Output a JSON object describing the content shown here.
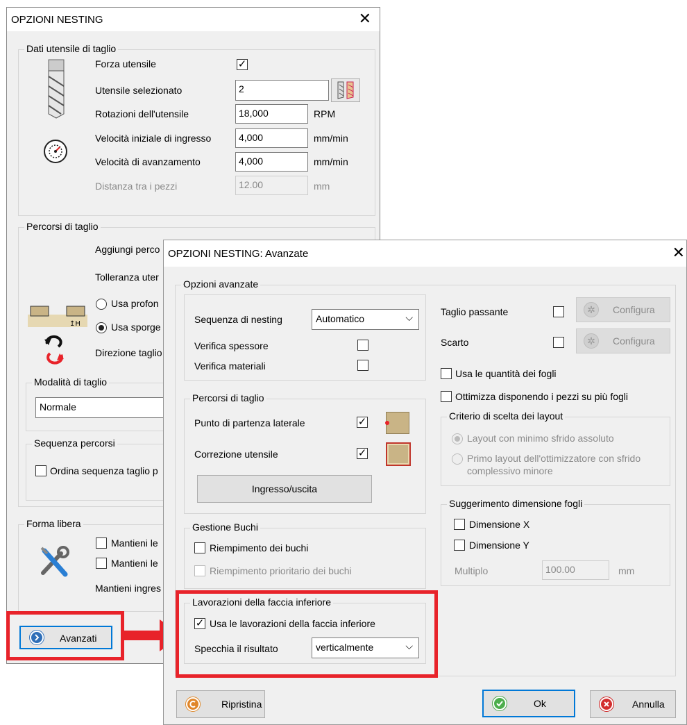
{
  "main": {
    "title": "OPZIONI NESTING",
    "close": "✕",
    "tool_group": {
      "label": "Dati utensile di taglio",
      "force_label": "Forza utensile",
      "force_checked": "✓",
      "selected_label": "Utensile selezionato",
      "selected_value": "2",
      "rotation_label": "Rotazioni dell'utensile",
      "rotation_value": "18,000",
      "rotation_unit": "RPM",
      "entry_speed_label": "Velocità iniziale di ingresso",
      "entry_speed_value": "4,000",
      "entry_speed_unit": "mm/min",
      "feed_label": "Velocità di avanzamento",
      "feed_value": "4,000",
      "feed_unit": "mm/min",
      "distance_label": "Distanza tra i pezzi",
      "distance_value": "12.00",
      "distance_unit": "mm"
    },
    "paths_group": {
      "label": "Percorsi di taglio",
      "add_label": "Aggiungi perco",
      "tolerance_label": "Tolleranza uter",
      "radio1_label": "Usa profon",
      "radio2_label": "Usa sporge",
      "direction_label": "Direzione taglio"
    },
    "mode_group": {
      "label": "Modalità di taglio",
      "value": "Normale"
    },
    "sequence_group": {
      "label": "Sequenza percorsi",
      "check_label": "Ordina sequenza taglio p"
    },
    "free_group": {
      "label": "Forma libera",
      "check1_label": "Mantieni le",
      "check2_label": "Mantieni le",
      "entry_label": "Mantieni ingres"
    },
    "advanced_button": "Avanzati"
  },
  "adv": {
    "title": "OPZIONI NESTING: Avanzate",
    "close": "✕",
    "group_label": "Opzioni avanzate",
    "nesting_seq_label": "Sequenza di nesting",
    "nesting_seq_value": "Automatico",
    "verify_thickness": "Verifica spessore",
    "verify_materials": "Verifica materiali",
    "paths": {
      "label": "Percorsi di taglio",
      "start_label": "Punto di partenza laterale",
      "start_checked": "✓",
      "correction_label": "Correzione utensile",
      "correction_checked": "✓",
      "inout_button": "Ingresso/uscita"
    },
    "holes": {
      "label": "Gestione Buchi",
      "fill_label": "Riempimento dei buchi",
      "priority_label": "Riempimento prioritario dei buchi"
    },
    "bottom": {
      "label": "Lavorazioni della faccia inferiore",
      "use_label": "Usa le lavorazioni della faccia inferiore",
      "use_checked": "✓",
      "mirror_label": "Specchia il risultato",
      "mirror_value": "verticalmente"
    },
    "right": {
      "through_cut": "Taglio passante",
      "scrap": "Scarto",
      "configure": "Configura",
      "use_sheet_qty": "Usa le quantità dei fogli",
      "optimize_multi": "Ottimizza disponendo i pezzi su più fogli",
      "criteria_label": "Criterio di scelta dei layout",
      "criteria_opt1": "Layout con minimo sfrido assoluto",
      "criteria_opt2_line1": "Primo layout dell'ottimizzatore con sfrido",
      "criteria_opt2_line2": "complessivo minore",
      "suggest_label": "Suggerimento dimensione fogli",
      "dim_x": "Dimensione X",
      "dim_y": "Dimensione Y",
      "multiple_label": "Multiplo",
      "multiple_value": "100.00",
      "multiple_unit": "mm"
    },
    "reset_button": "Ripristina",
    "ok_button": "Ok",
    "cancel_button": "Annulla"
  },
  "colors": {
    "highlight_red": "#e8232a",
    "focus_blue": "#0078d7",
    "swatch_tan": "#c9b486"
  }
}
